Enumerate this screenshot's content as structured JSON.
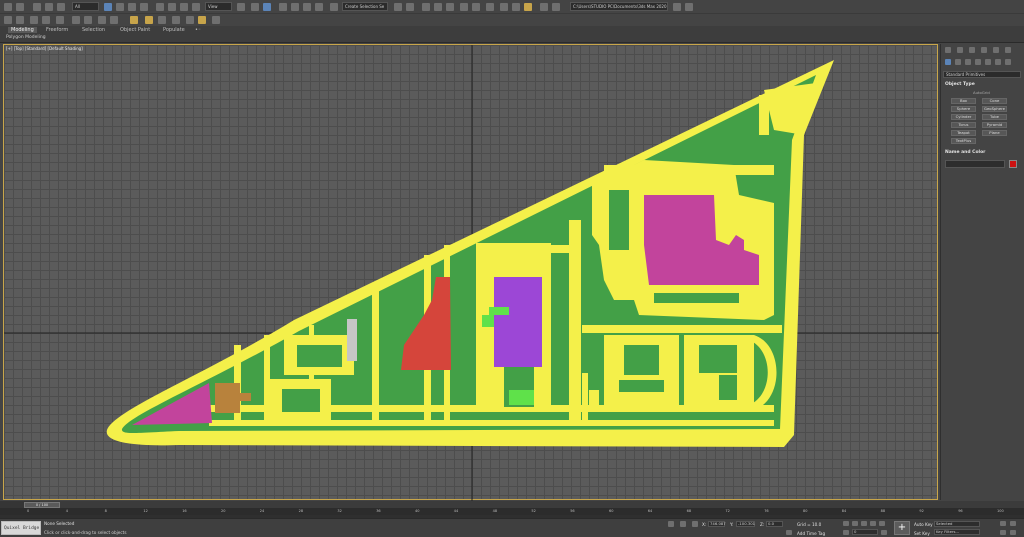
{
  "toolbar": {
    "selection_filter": "All",
    "view_ref": "View",
    "named_selection_placeholder": "Create Selection Se",
    "project_path": "C:\\Users\\STUDIO PC\\Documents\\3ds Max 2020"
  },
  "ribbon": {
    "tabs": [
      "Modeling",
      "Freeform",
      "Selection",
      "Object Paint",
      "Populate"
    ],
    "active_tab": 0,
    "sub_label": "Polygon Modeling"
  },
  "viewport": {
    "label": "[+] [Top] [Standard] [Default Shading]"
  },
  "command_panel": {
    "category": "Standard Primitives",
    "object_type_title": "Object Type",
    "autogrid": "AutoGrid",
    "objects": [
      "Box",
      "Cone",
      "Sphere",
      "GeoSphere",
      "Cylinder",
      "Tube",
      "Torus",
      "Pyramid",
      "Teapot",
      "Plane",
      "TextPlus"
    ],
    "name_color_title": "Name and Color",
    "color": "#cc1111"
  },
  "timeline": {
    "frame": "0 / 100",
    "ticks": [
      "0",
      "4",
      "8",
      "12",
      "16",
      "20",
      "24",
      "28",
      "32",
      "36",
      "40",
      "44",
      "48",
      "52",
      "56",
      "60",
      "64",
      "68",
      "72",
      "76",
      "80",
      "84",
      "88",
      "92",
      "96",
      "100"
    ]
  },
  "status": {
    "script_label": "Quixel Bridge",
    "selection": "None Selected",
    "prompt": "Click or click-and-drag to select objects",
    "x_label": "X:",
    "x_value": "746.087",
    "y_label": "Y:",
    "y_value": "-100.301",
    "z_label": "Z:",
    "z_value": "0.0",
    "grid": "Grid = 10.0",
    "add_time_tag": "Add Time Tag",
    "auto_key": "Auto Key",
    "set_key": "Set Key",
    "key_mode": "Selected",
    "key_filters": "Key Filters...",
    "frame_field": "0"
  },
  "colors": {
    "site_fill": "#43a047",
    "road": "#f4f04a",
    "building_magenta": "#c2449c",
    "building_purple": "#9c47d6",
    "building_red": "#d5453b",
    "building_brown": "#b8823c",
    "lime": "#5fe14a",
    "viewport_border": "#c8a64a"
  }
}
